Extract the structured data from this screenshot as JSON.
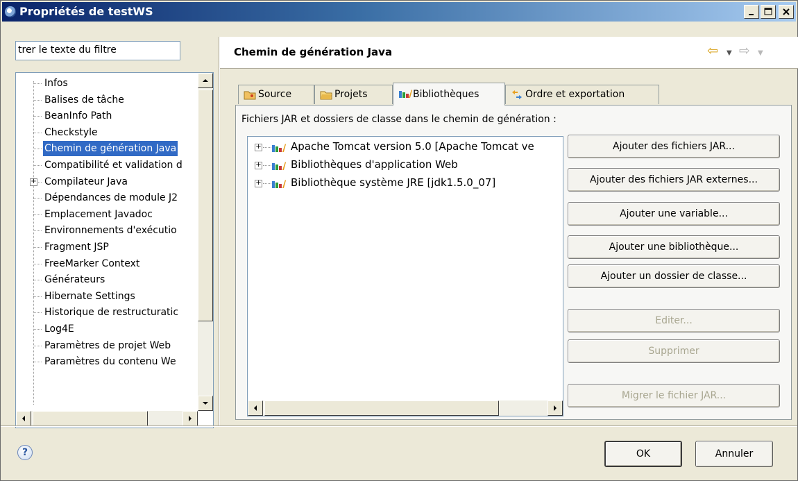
{
  "window": {
    "title": "Propriétés de testWS"
  },
  "left": {
    "filter_value": "trer le texte du filtre",
    "tree": [
      {
        "label": "Infos"
      },
      {
        "label": "Balises de tâche"
      },
      {
        "label": "BeanInfo Path"
      },
      {
        "label": "Checkstyle"
      },
      {
        "label": "Chemin de génération Java",
        "selected": true
      },
      {
        "label": "Compatibilité et validation d"
      },
      {
        "label": "Compilateur Java",
        "expandable": true
      },
      {
        "label": "Dépendances de module J2"
      },
      {
        "label": "Emplacement Javadoc"
      },
      {
        "label": "Environnements d'exécutio"
      },
      {
        "label": "Fragment JSP"
      },
      {
        "label": "FreeMarker Context"
      },
      {
        "label": "Générateurs"
      },
      {
        "label": "Hibernate Settings"
      },
      {
        "label": "Historique de restructuratic"
      },
      {
        "label": "Log4E"
      },
      {
        "label": "Paramètres de projet Web"
      },
      {
        "label": "Paramètres du contenu We"
      }
    ]
  },
  "right": {
    "title": "Chemin de génération Java",
    "tabs": [
      {
        "label": "Source"
      },
      {
        "label": "Projets"
      },
      {
        "label": "Bibliothèques",
        "active": true
      },
      {
        "label": "Ordre et exportation"
      }
    ],
    "jar_label": "Fichiers JAR et dossiers de classe dans le chemin de génération :",
    "libraries": [
      {
        "label": "Apache Tomcat version 5.0 [Apache Tomcat ve"
      },
      {
        "label": "Bibliothèques d'application Web"
      },
      {
        "label": "Bibliothèque système JRE [jdk1.5.0_07]"
      }
    ],
    "buttons": {
      "add_jars": "Ajouter des fichiers JAR...",
      "add_external_jars": "Ajouter des fichiers JAR externes...",
      "add_variable": "Ajouter une variable...",
      "add_library": "Ajouter une bibliothèque...",
      "add_class_folder": "Ajouter un dossier de classe...",
      "edit": "Editer...",
      "remove": "Supprimer",
      "migrate": "Migrer le fichier JAR..."
    }
  },
  "footer": {
    "help": "?",
    "ok": "OK",
    "cancel": "Annuler"
  },
  "colors": {
    "selection": "#316ac5",
    "title_start": "#0a246a",
    "title_end": "#a6caf0",
    "dialog_bg": "#ece9d8"
  }
}
